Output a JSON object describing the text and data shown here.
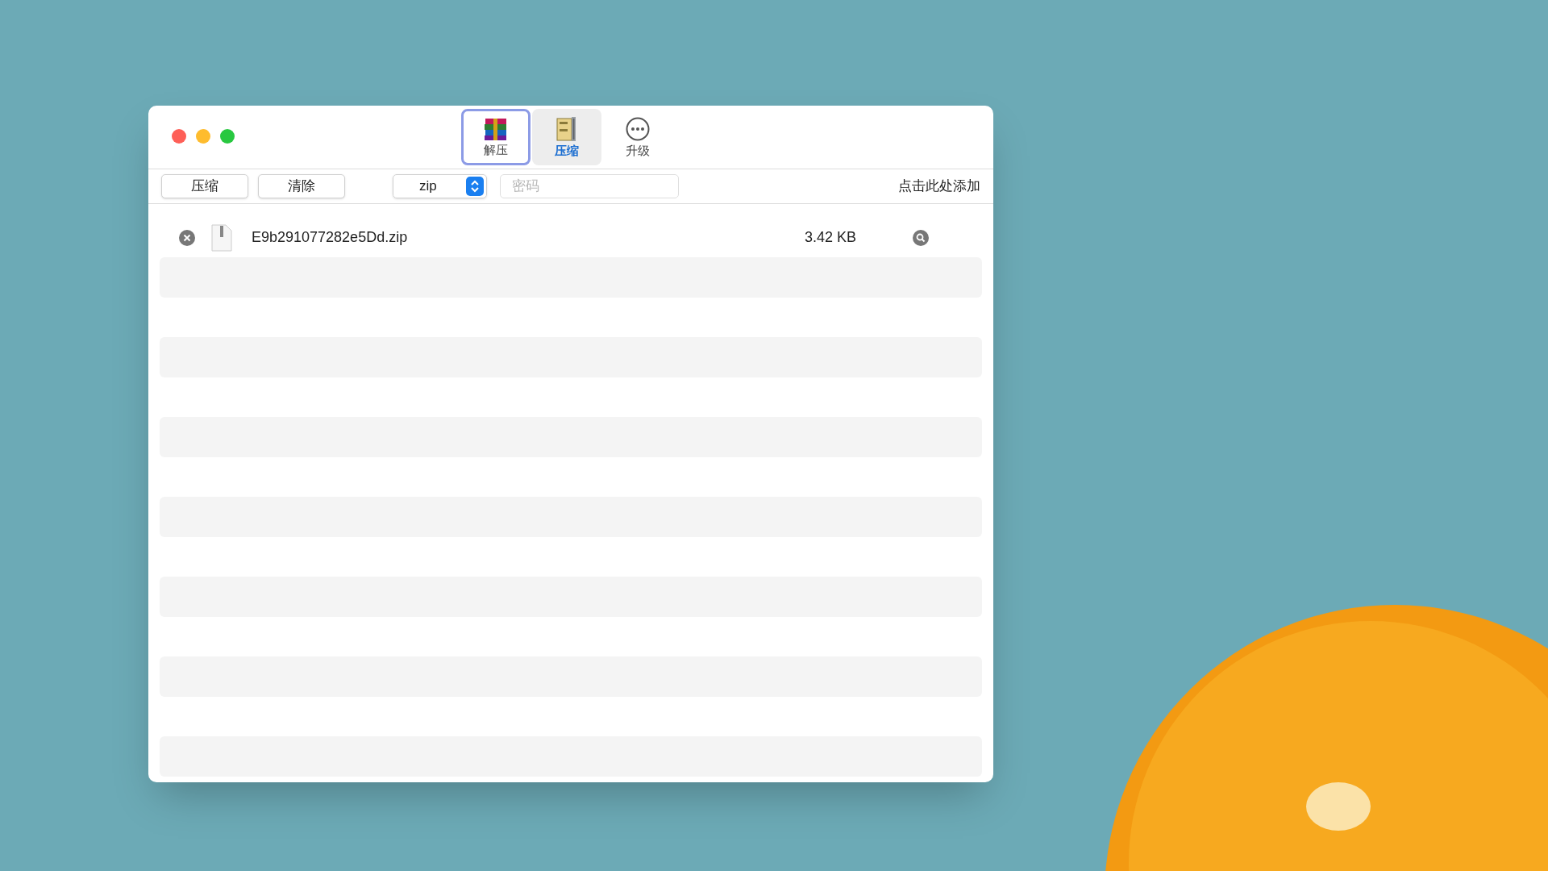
{
  "toolbar_tabs": [
    {
      "kind": "extract",
      "label": "解压",
      "selected": false,
      "focused": true
    },
    {
      "kind": "compress",
      "label": "压缩",
      "selected": true,
      "focused": false
    },
    {
      "kind": "upgrade",
      "label": "升级",
      "selected": false,
      "focused": false
    }
  ],
  "actions": [
    "压缩",
    "清除"
  ],
  "format_select": {
    "value": "zip"
  },
  "password": {
    "placeholder": "密码"
  },
  "add_hint": "点击此处添加",
  "files": [
    {
      "name": "E9b291077282e5Dd.zip",
      "size": "3.42 KB"
    }
  ]
}
